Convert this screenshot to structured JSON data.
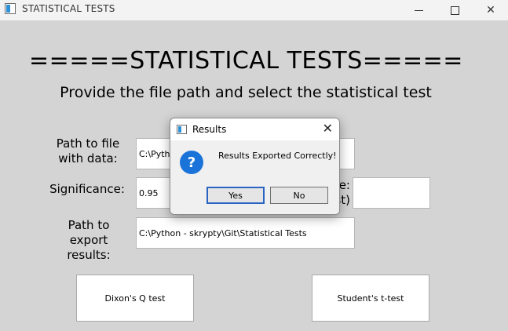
{
  "window": {
    "title": "STATISTICAL TESTS",
    "controls": {
      "minimize": "—",
      "maximize": "□",
      "close": "✕"
    }
  },
  "main": {
    "heading": "=====STATISTICAL TESTS=====",
    "subheading": "Provide the file path and select the statistical test",
    "fields": {
      "path_label_1": "Path to file",
      "path_label_2": "with data:",
      "path_value": "C:\\Python",
      "significance_label": "Significance:",
      "significance_value": "0.95",
      "hidden_label_1": "e:",
      "hidden_label_2": "st)",
      "export_label_1": "Path to",
      "export_label_2": "export results:",
      "export_value": "C:\\Python - skrypty\\Git\\Statistical Tests"
    },
    "buttons": {
      "dixon": "Dixon's Q test",
      "student": "Student's t-test"
    }
  },
  "dialog": {
    "title": "Results",
    "close": "✕",
    "icon": "question-icon",
    "icon_glyph": "?",
    "message": "Results Exported Correctly!",
    "yes": "Yes",
    "no": "No"
  }
}
